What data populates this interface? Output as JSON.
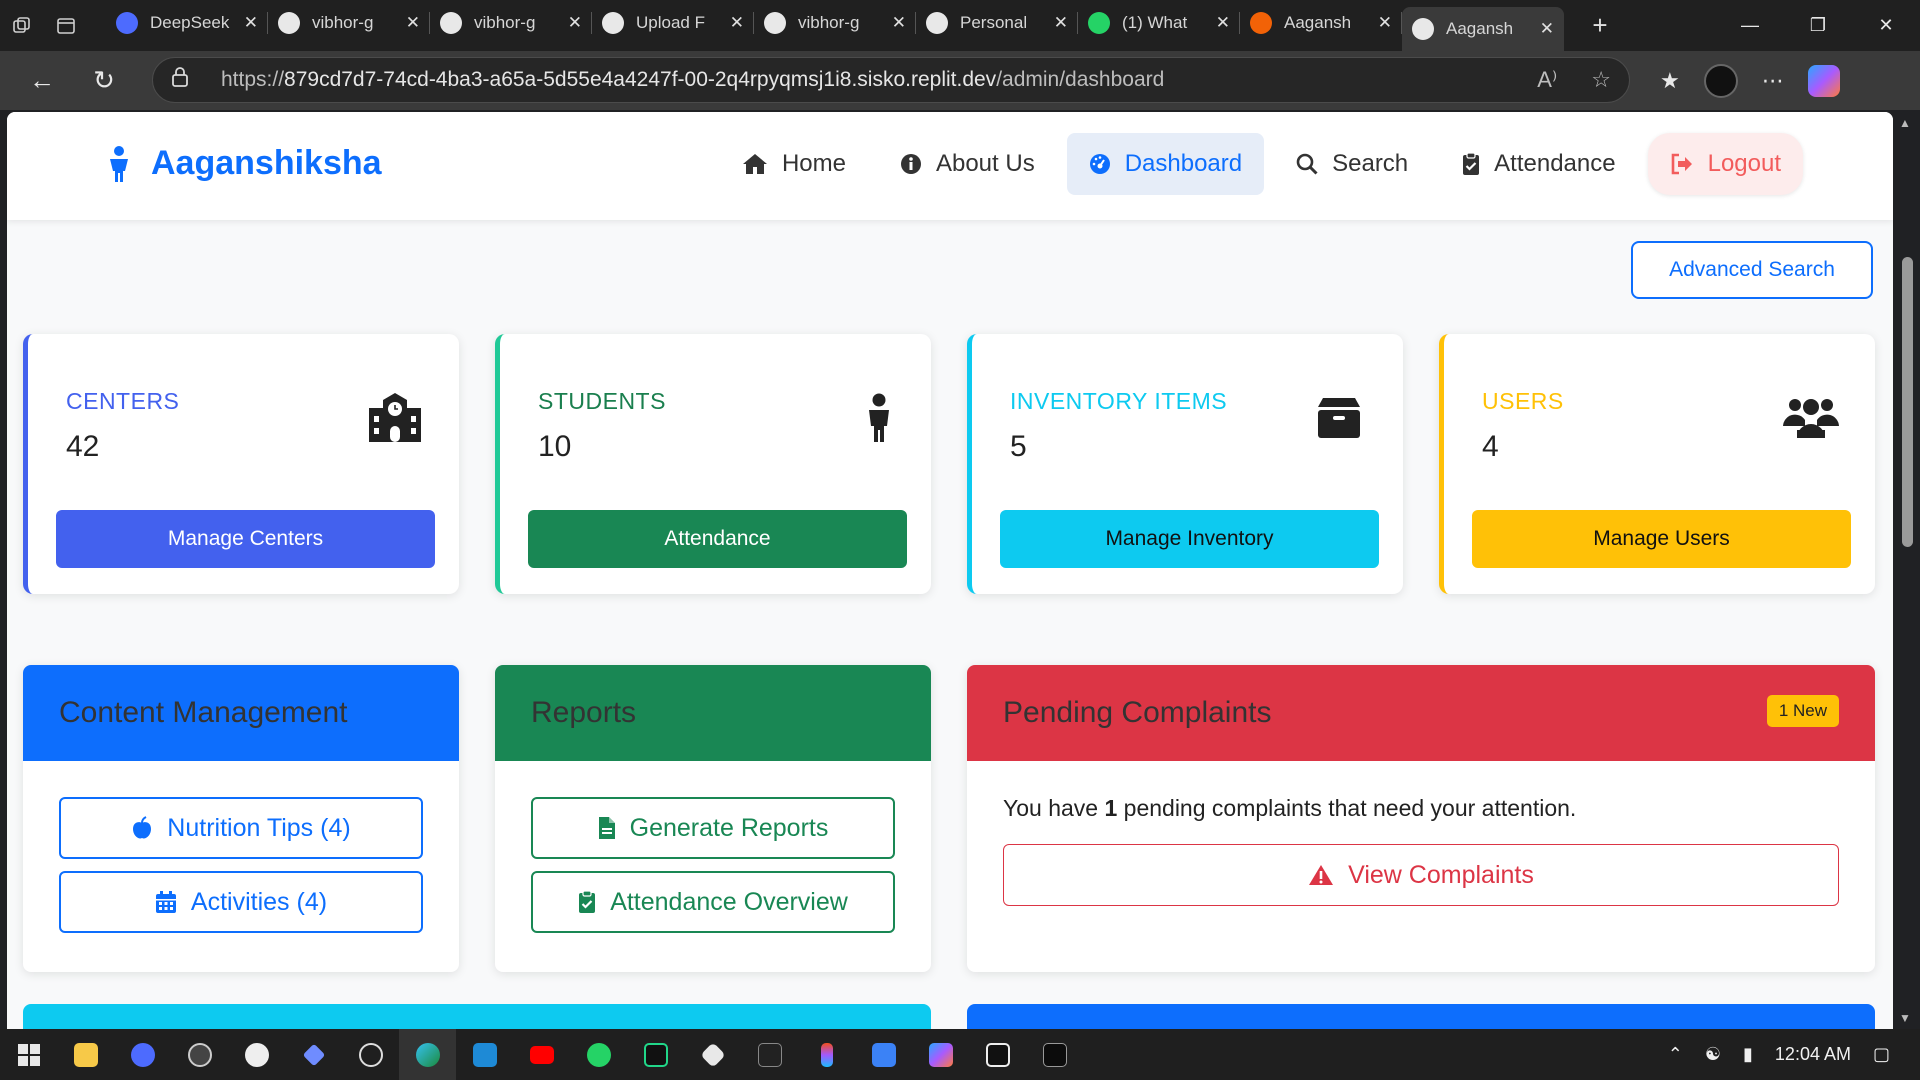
{
  "browser": {
    "tabs": [
      {
        "title": "DeepSeek",
        "favicon": "deepseek-icon",
        "color": "#4d6bfe"
      },
      {
        "title": "vibhor-g",
        "favicon": "github-icon",
        "color": "#e8e8e8"
      },
      {
        "title": "vibhor-g",
        "favicon": "github-icon",
        "color": "#e8e8e8"
      },
      {
        "title": "Upload F",
        "favicon": "openai-icon",
        "color": "#e8e8e8"
      },
      {
        "title": "vibhor-g",
        "favicon": "github-icon",
        "color": "#e8e8e8"
      },
      {
        "title": "Personal",
        "favicon": "github-icon",
        "color": "#e8e8e8"
      },
      {
        "title": "(1) What",
        "favicon": "whatsapp-icon",
        "color": "#25d366"
      },
      {
        "title": "Aagansh",
        "favicon": "replit-icon",
        "color": "#f26207"
      },
      {
        "title": "Aagansh",
        "favicon": "globe-icon",
        "color": "#e8e8e8"
      }
    ],
    "url_prefix": "https://",
    "url_host": "879cd7d7-74cd-4ba3-a65a-5d55e4a4247f-00-2q4rpyqmsj1i8.sisko.replit.dev",
    "url_path": "/admin/dashboard"
  },
  "site": {
    "brand_a": "Aagan",
    "brand_b": "shiksha",
    "nav": [
      {
        "label": "Home",
        "icon": "home-icon"
      },
      {
        "label": "About Us",
        "icon": "info-icon"
      },
      {
        "label": "Dashboard",
        "icon": "dashboard-icon"
      },
      {
        "label": "Search",
        "icon": "search-icon"
      },
      {
        "label": "Attendance",
        "icon": "clipboard-check-icon"
      },
      {
        "label": "Logout",
        "icon": "logout-icon"
      }
    ],
    "advanced_search": "Advanced Search"
  },
  "stats": [
    {
      "label": "CENTERS",
      "value": "42",
      "button": "Manage Centers",
      "color": "#4361ee",
      "icon": "school-icon"
    },
    {
      "label": "STUDENTS",
      "value": "10",
      "button": "Attendance",
      "color": "#198754",
      "icon": "child-icon"
    },
    {
      "label": "INVENTORY ITEMS",
      "value": "5",
      "button": "Manage Inventory",
      "color": "#0dcaf0",
      "icon": "box-icon"
    },
    {
      "label": "USERS",
      "value": "4",
      "button": "Manage Users",
      "color": "#ffc107",
      "icon": "users-icon"
    }
  ],
  "panels": {
    "content": {
      "title": "Content Management",
      "buttons": [
        {
          "label": "Nutrition Tips (4)",
          "icon": "apple-icon"
        },
        {
          "label": "Activities (4)",
          "icon": "calendar-icon"
        }
      ]
    },
    "reports": {
      "title": "Reports",
      "buttons": [
        {
          "label": "Generate Reports",
          "icon": "file-icon"
        },
        {
          "label": "Attendance Overview",
          "icon": "clipboard-check-icon"
        }
      ]
    },
    "complaints": {
      "title": "Pending Complaints",
      "badge": "1 New",
      "text_a": "You have ",
      "count": "1",
      "text_b": " pending complaints that need your attention.",
      "button": "View Complaints",
      "button_icon": "warning-icon"
    }
  },
  "colors": {
    "primary": "#0d6efd",
    "success": "#198754",
    "danger": "#dc3545",
    "info": "#0dcaf0",
    "warning": "#ffc107"
  },
  "taskbar": {
    "time": "12:04 AM"
  }
}
